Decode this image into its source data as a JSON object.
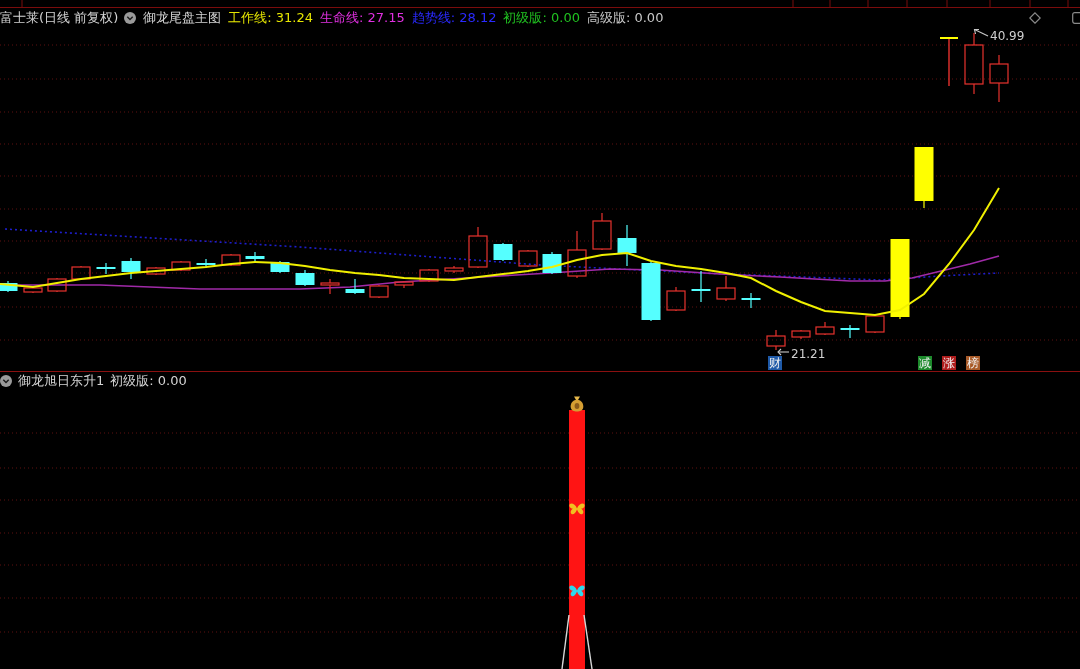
{
  "chart_header": {
    "security": "富士莱(日线 前复权)",
    "indicator": "御龙尾盘主图",
    "values": [
      {
        "text": "工作线: 31.24",
        "color": "#e6e600"
      },
      {
        "text": "生命线: 27.15",
        "color": "#e030e0"
      },
      {
        "text": "趋势线: 28.12",
        "color": "#2a2aff"
      },
      {
        "text": "初级版: 0.00",
        "color": "#20c020"
      },
      {
        "text": "高级版: 0.00",
        "color": "#c8c8c8"
      }
    ]
  },
  "main_chart": {
    "high_label": "40.99",
    "low_label": "21.21",
    "signals": [
      {
        "text": "财",
        "color": "#1f5aa8"
      },
      {
        "text": "减",
        "color": "#1d8a2c"
      },
      {
        "text": "涨",
        "color": "#b01e1e"
      },
      {
        "text": "榜",
        "color": "#a85a28"
      }
    ]
  },
  "sub_chart": {
    "indicator": "御龙旭日东升1",
    "values": [
      {
        "text": "初级版: 0.00"
      }
    ]
  }
}
